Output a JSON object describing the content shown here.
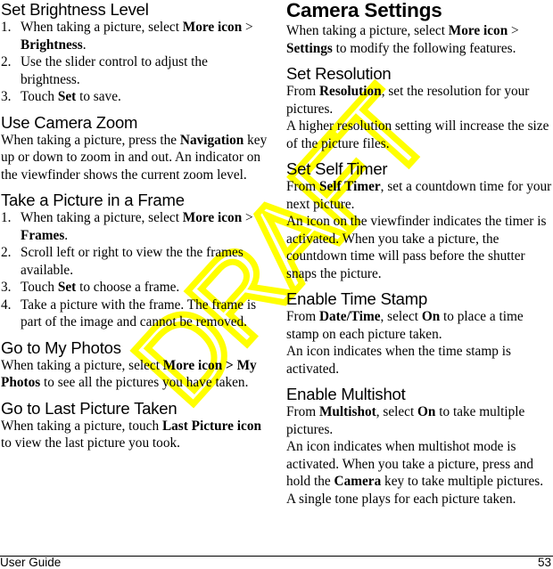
{
  "left_column": {
    "brightness": {
      "heading": "Set Brightness Level",
      "steps": [
        {
          "num": "1.",
          "pre": "When taking a picture, select ",
          "b1": "More icon",
          "mid": " > ",
          "b2": "Brightness",
          "post": "."
        },
        {
          "num": "2.",
          "text": "Use the slider control to adjust the brightness."
        },
        {
          "num": "3.",
          "pre": "Touch ",
          "b1": "Set",
          "post": " to save."
        }
      ]
    },
    "zoom": {
      "heading": "Use Camera Zoom",
      "pre": "When taking a picture, press the ",
      "b1": "Navigation",
      "post": " key up or down to zoom in and out. An indicator on the viewfinder shows the current zoom level."
    },
    "frame": {
      "heading": "Take a Picture in a Frame",
      "steps": [
        {
          "num": "1.",
          "pre": "When taking a picture, select ",
          "b1": "More icon",
          "mid": " > ",
          "b2": "Frames",
          "post": "."
        },
        {
          "num": "2.",
          "text": "Scroll left or right to view the the frames available."
        },
        {
          "num": "3.",
          "pre": "Touch ",
          "b1": "Set",
          "post": " to choose a frame."
        },
        {
          "num": "4.",
          "text": "Take a picture with the frame. The frame is part of the image and cannot be removed."
        }
      ]
    },
    "photos": {
      "heading": "Go to My Photos",
      "pre": "When taking a picture, select ",
      "b1": "More icon > My Photos",
      "post": " to see all the pictures you have taken."
    },
    "last": {
      "heading": "Go to Last Picture Taken",
      "pre": "When taking a picture, touch ",
      "b1": "Last Picture icon",
      "post": " to view the last picture you took."
    }
  },
  "right_column": {
    "settings": {
      "title": "Camera Settings",
      "pre": "When taking a picture, select ",
      "b1": "More icon",
      "mid": " > ",
      "b2": "Settings",
      "post": " to modify the following features."
    },
    "resolution": {
      "heading": "Set Resolution",
      "p1_pre": "From ",
      "p1_b": "Resolution",
      "p1_post": ", set the resolution for your pictures.",
      "p2": "A higher resolution setting will increase the size of the picture files."
    },
    "timer": {
      "heading": "Set Self Timer",
      "p1_pre": "From ",
      "p1_b": "Self Timer",
      "p1_post": ", set a countdown time for your next picture.",
      "p2": "An icon on the viewfinder indicates the timer is activated. When you take a picture, the countdown time will pass before the shutter snaps the picture."
    },
    "timestamp": {
      "heading": "Enable Time Stamp",
      "p1_pre": "From ",
      "p1_b": "Date/Time",
      "p1_mid": ", select ",
      "p1_b2": "On",
      "p1_post": " to place a time stamp on each picture taken.",
      "p2": "An icon indicates when the time stamp is activated."
    },
    "multishot": {
      "heading": "Enable Multishot",
      "p1_pre": "From ",
      "p1_b": "Multishot",
      "p1_mid": ", select ",
      "p1_b2": "On",
      "p1_post": " to take multiple pictures.",
      "p2_pre": "An icon indicates when multishot mode is activated. When you take a picture, press and hold the ",
      "p2_b": "Camera",
      "p2_post": " key to take multiple pictures. A single tone plays for each picture taken."
    }
  },
  "footer": {
    "left": "User Guide",
    "page_number": "53"
  },
  "watermark": {
    "text": "DRAFT",
    "color": "#ffff00"
  }
}
